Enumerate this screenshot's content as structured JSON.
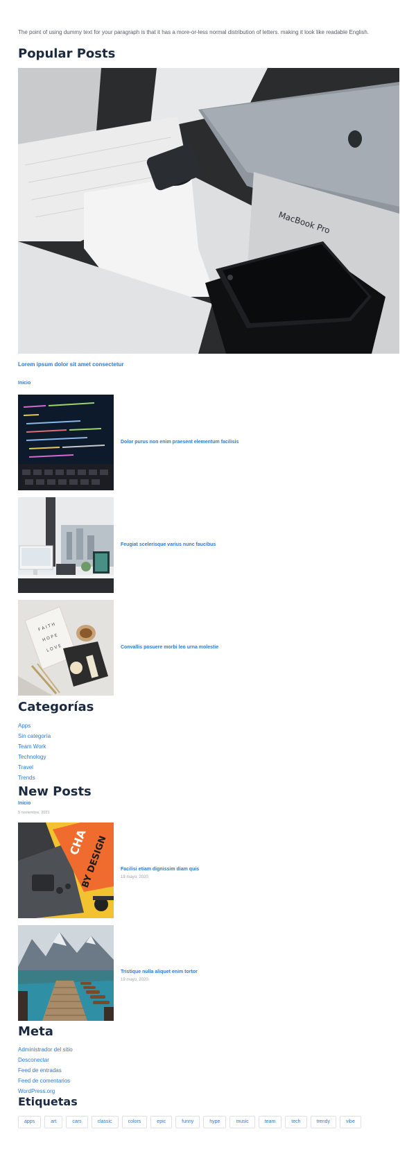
{
  "intro_text": "The point of using dummy text for your paragraph is that it has a more-or-less normal distribution of letters. making it look like readable English.",
  "popular": {
    "title": "Popular Posts",
    "hero_link": "Lorem ipsum dolor sit amet consectetur",
    "inicio": "Inicio",
    "posts": [
      {
        "title": "Dolor purus non enim praesent elementum facilisis"
      },
      {
        "title": "Feugiat scelerisque varius nunc faucibus"
      },
      {
        "title": "Convallis posuere morbi leo urna molestie"
      }
    ],
    "hero_image_text": "MacBook Pro"
  },
  "categories": {
    "title": "Categorías",
    "items": [
      "Apps",
      "Sin categoría",
      "Team Work",
      "Technology",
      "Travel",
      "Trends"
    ]
  },
  "new_posts": {
    "title": "New Posts",
    "first_link": "Inicio",
    "first_date": "5 noviembre, 2021",
    "posts": [
      {
        "title": "Facilisi etiam dignissim diam quis",
        "date": "19 mayo, 2020",
        "image_text_1": "CHA",
        "image_text_2": "BY DESIGN"
      },
      {
        "title": "Tristique nulla aliquet enim tortor",
        "date": "19 mayo, 2020"
      }
    ]
  },
  "meta": {
    "title": "Meta",
    "items": [
      "Administrador del sitio",
      "Desconectar",
      "Feed de entradas",
      "Feed de comentarios",
      "WordPress.org"
    ]
  },
  "tags": {
    "title": "Etiquetas",
    "items": [
      "apps",
      "art",
      "cars",
      "classic",
      "colors",
      "epic",
      "funny",
      "hype",
      "music",
      "team",
      "tech",
      "trendy",
      "vibe"
    ]
  },
  "colors": {
    "link": "#2e78d8",
    "heading": "#1b2a40",
    "muted": "#9aa0a8"
  }
}
